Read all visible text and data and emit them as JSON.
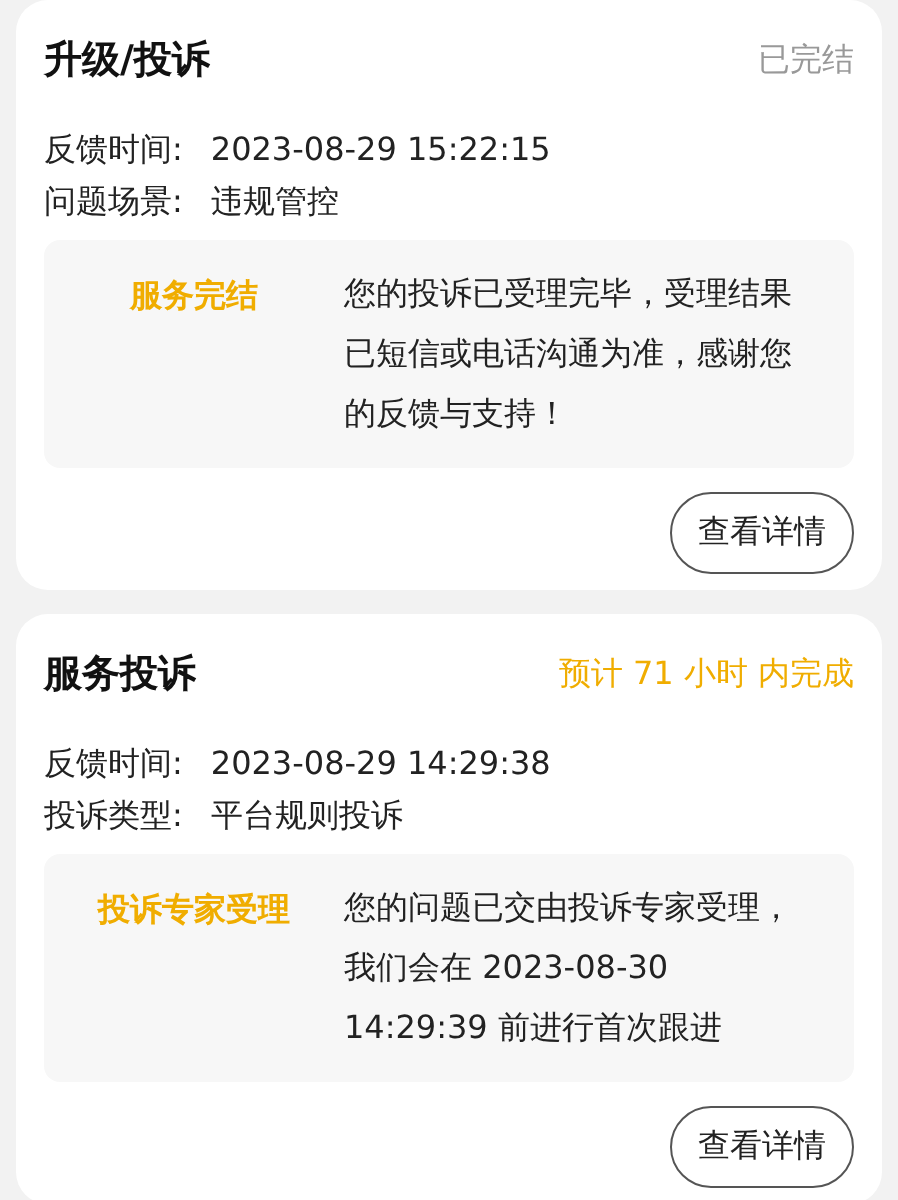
{
  "cards": [
    {
      "title": "升级/投诉",
      "status": {
        "kind": "done",
        "text": "已完结"
      },
      "fields": [
        {
          "label": "反馈时间:",
          "value": "2023-08-29 15:22:15"
        },
        {
          "label": "问题场景:",
          "value": "违规管控"
        }
      ],
      "notice": {
        "label": "服务完结",
        "text": "您的投诉已受理完毕，受理结果已短信或电话沟通为准，感谢您的反馈与支持！"
      },
      "button": "查看详情"
    },
    {
      "title": "服务投诉",
      "status": {
        "kind": "eta",
        "text": "预计 71 小时 内完成"
      },
      "fields": [
        {
          "label": "反馈时间:",
          "value": "2023-08-29 14:29:38"
        },
        {
          "label": "投诉类型:",
          "value": "平台规则投诉"
        }
      ],
      "notice": {
        "label": "投诉专家受理",
        "text": "您的问题已交由投诉专家受理，我们会在 2023-08-30 14:29:39 前进行首次跟进"
      },
      "button": "查看详情"
    }
  ]
}
